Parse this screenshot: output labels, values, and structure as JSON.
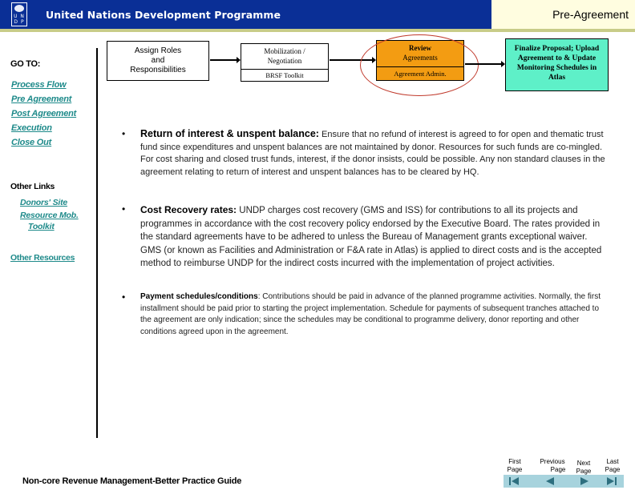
{
  "header": {
    "org_name": "United Nations Development Programme",
    "logo_letters": "U N D P",
    "page_title": "Pre-Agreement",
    "colors": {
      "header_bg": "#0a2f96",
      "title_bg": "#fffde0",
      "stripe": "#c8cc88"
    }
  },
  "sidebar": {
    "goto_label": "GO TO:",
    "goto_links": [
      {
        "label": "Process Flow"
      },
      {
        "label": "Pre Agreement"
      },
      {
        "label": "Post Agreement"
      },
      {
        "label": "Execution"
      },
      {
        "label": "Close Out"
      }
    ],
    "other_links_label": "Other Links",
    "other_links": [
      {
        "label": "Donors' Site"
      },
      {
        "label": "Resource Mob."
      },
      {
        "label": "Toolkit"
      }
    ],
    "other_resources_label": "Other Resources",
    "link_color": "#1e8a8a"
  },
  "flow": {
    "step1": {
      "label_lines": [
        "Assign Roles",
        "and",
        "Responsibilities"
      ]
    },
    "step2": {
      "label_lines": [
        "Mobilization /",
        "Negotiation"
      ],
      "sub": "BRSF Toolkit"
    },
    "step3": {
      "label_lines": [
        "Review",
        "Agreements"
      ],
      "sub": "Agreement Admin.",
      "color": "#f39c12",
      "highlighted": true
    },
    "step4": {
      "label_lines": [
        "Finalize Proposal; Upload",
        "Agreement to & Update",
        "Monitoring Schedules in",
        "Atlas"
      ],
      "color": "#5ef0c8"
    }
  },
  "content": {
    "bullets": [
      {
        "heading": "Return of interest  & unspent balance:",
        "text": " Ensure that no refund of interest is agreed to for open and thematic trust fund since expenditures and unspent balances are not maintained by donor. Resources for such funds are co-mingled.   For cost sharing and closed trust funds, interest, if the donor insists, could be possible. Any non standard clauses in the agreement relating to return of interest and unspent balances has to be cleared by HQ."
      },
      {
        "heading": "Cost Recovery rates:",
        "text": " UNDP charges cost recovery (GMS and ISS) for contributions to all its projects and programmes in accordance with the cost recovery policy endorsed by the Executive Board. The rates provided in the standard agreements have to be adhered to unless the Bureau of Management grants exceptional waiver.   GMS (or known as Facilities and Administration or F&A rate in Atlas) is applied to direct costs and is the accepted method to reimburse UNDP for the indirect costs incurred with the implementation of project activities."
      },
      {
        "heading": "Payment schedules/conditions",
        "text": ":  Contributions should be paid in advance of the planned programme activities.  Normally, the first installment should be paid prior to starting the project implementation.  Schedule for payments of subsequent tranches attached to the agreement are only indication; since the schedules may be conditional to programme delivery, donor reporting and other conditions agreed upon in the agreement."
      }
    ]
  },
  "footer": {
    "title": "Non-core Revenue Management-Better Practice Guide",
    "nav": [
      {
        "line1": "First",
        "line2": "Page",
        "icon": "first-page-icon"
      },
      {
        "line1": "Previous",
        "line2": "Page",
        "icon": "previous-page-icon"
      },
      {
        "line1": "Next",
        "line2": "Page",
        "icon": "next-page-icon"
      },
      {
        "line1": "Last",
        "line2": "Page",
        "icon": "last-page-icon"
      }
    ]
  }
}
